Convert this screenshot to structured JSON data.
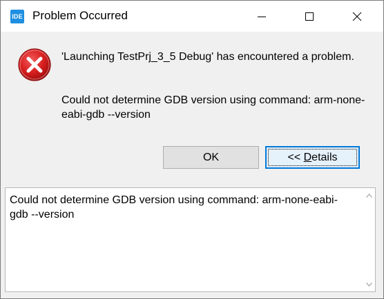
{
  "window": {
    "app_icon_text": "IDE",
    "title": "Problem Occurred"
  },
  "icons": {
    "app": "ide-app-icon",
    "error": "error-icon",
    "minimize": "minimize-icon",
    "maximize": "maximize-icon",
    "close": "close-icon"
  },
  "message": {
    "line1": "'Launching TestPrj_3_5 Debug' has encountered a problem.",
    "line2": "Could not determine GDB version using command: arm-none-eabi-gdb --version"
  },
  "buttons": {
    "ok_label": "OK",
    "details_prefix": "<< ",
    "details_underlined": "D",
    "details_rest": "etails"
  },
  "details": {
    "text": "Could not determine GDB version using command: arm-none-eabi-gdb --version"
  },
  "colors": {
    "accent": "#0078d7",
    "error_red": "#e81123",
    "app_icon_blue": "#1e8fe1"
  }
}
